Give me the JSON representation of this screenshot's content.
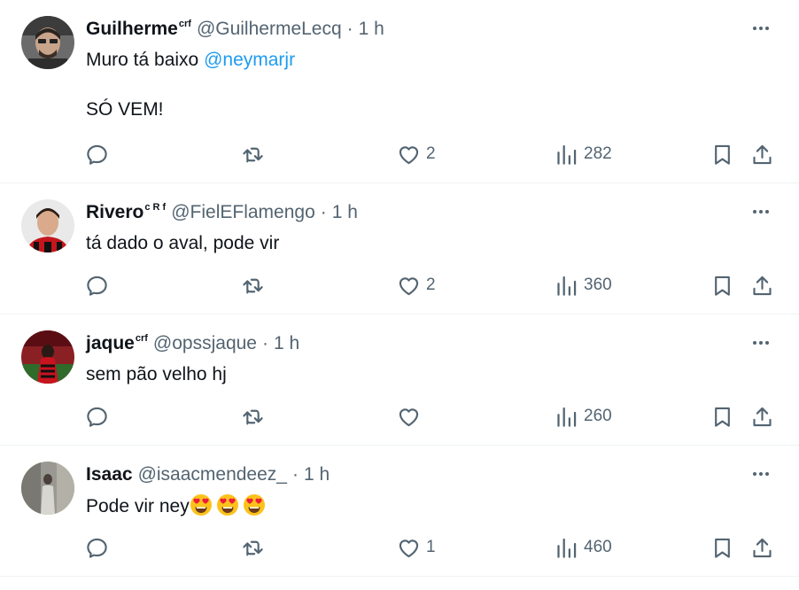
{
  "tweets": [
    {
      "name": "Guilherme",
      "badge": "crf",
      "handle": "@GuilhermeLecq",
      "separator": "·",
      "time": "1 h",
      "text_lines": [
        "Muro tá baixo ",
        "",
        "SÓ VEM!"
      ],
      "mention": "@neymarjr",
      "reply_count": "",
      "retweet_count": "",
      "like_count": "2",
      "view_count": "282"
    },
    {
      "name": "Rivero",
      "badge": "c R f",
      "handle": "@FielEFlamengo",
      "separator": "·",
      "time": "1 h",
      "text_lines": [
        "tá dado o aval, pode vir"
      ],
      "reply_count": "",
      "retweet_count": "",
      "like_count": "2",
      "view_count": "360"
    },
    {
      "name": "jaque",
      "badge": "crf",
      "handle": "@opssjaque",
      "separator": "·",
      "time": "1 h",
      "text_lines": [
        "sem pão velho hj"
      ],
      "reply_count": "",
      "retweet_count": "",
      "like_count": "",
      "view_count": "260"
    },
    {
      "name": "Isaac",
      "badge": "",
      "handle": "@isaacmendeez_",
      "separator": "·",
      "time": "1 h",
      "text_lines": [
        "Pode vir ney"
      ],
      "emoji": [
        "heart-eyes-emoji",
        "heart-eyes-emoji",
        "heart-eyes-emoji"
      ],
      "reply_count": "",
      "retweet_count": "",
      "like_count": "1",
      "view_count": "460"
    }
  ],
  "colors": {
    "text": "#0f1419",
    "secondary": "#536471",
    "link": "#1d9bf0",
    "divider": "#eff3f4",
    "emoji_face": "#fcc21b",
    "emoji_heart": "#ed1c3b"
  },
  "icons": {
    "reply": "reply-icon",
    "retweet": "retweet-icon",
    "like": "heart-icon",
    "views": "views-chart-icon",
    "bookmark": "bookmark-icon",
    "share": "share-icon",
    "more": "more-dots-icon"
  }
}
